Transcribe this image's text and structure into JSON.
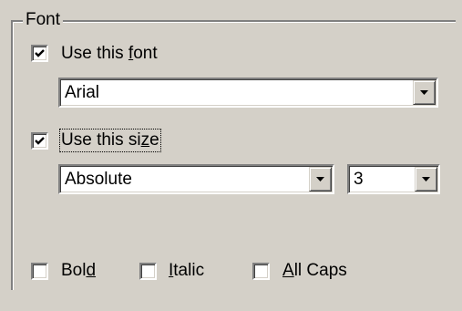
{
  "font_group": {
    "title": "Font",
    "use_font": {
      "pre": "Use this ",
      "key": "f",
      "post": "ont",
      "checked": true
    },
    "font_select": {
      "value": "Arial"
    },
    "use_size": {
      "pre": "Use this si",
      "key": "z",
      "post": "e",
      "checked": true
    },
    "size_mode_select": {
      "value": "Absolute"
    },
    "size_value_select": {
      "value": "3"
    },
    "bold": {
      "pre": "Bol",
      "key": "d",
      "post": "",
      "checked": false
    },
    "italic": {
      "pre": "",
      "key": "I",
      "post": "talic",
      "checked": false
    },
    "all_caps": {
      "pre": "",
      "key": "A",
      "post": "ll Caps",
      "checked": false
    }
  },
  "icons": {
    "check": "checkmark-icon",
    "dropdown": "dropdown-arrow-icon"
  }
}
